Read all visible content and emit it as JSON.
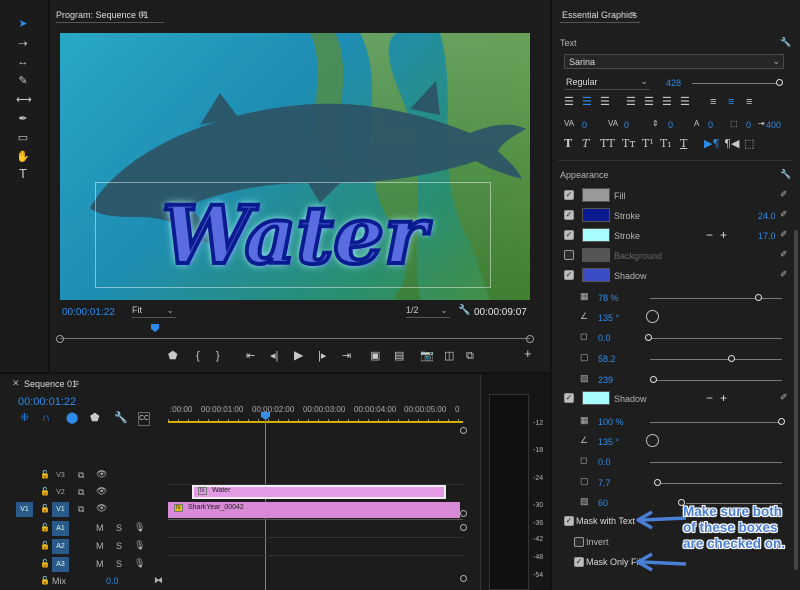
{
  "program": {
    "title": "Program: Sequence 01",
    "timecode_left": "00:00:01:22",
    "fit": "Fit",
    "resolution": "1/2",
    "timecode_right": "00:00:09:07",
    "preview_text": "Water"
  },
  "sequence": {
    "title": "Sequence 01",
    "timecode": "00:00:01:22",
    "ruler": [
      ":00:00",
      "00:00:01:00",
      "00:00:02:00",
      "00:00:03:00",
      "00:00:04:00",
      "00:00:05:00",
      "0"
    ],
    "tracks": [
      {
        "name": "V3",
        "src": ""
      },
      {
        "name": "V2",
        "src": ""
      },
      {
        "name": "V1",
        "src": "V1"
      },
      {
        "name": "A1",
        "src": ""
      },
      {
        "name": "A2",
        "src": ""
      },
      {
        "name": "A3",
        "src": ""
      }
    ],
    "mix_label": "Mix",
    "mix_value": "0.0",
    "clips": [
      {
        "label": "Water",
        "color": "#e39be6"
      },
      {
        "label": "SharkYear_00042",
        "color": "#d98ad6"
      }
    ],
    "meter_labels": [
      "-12",
      "-18",
      "-24",
      "-30",
      "-36",
      "-42",
      "-48",
      "-54"
    ]
  },
  "essential_graphics": {
    "title": "Essential Graphics",
    "text_section": "Text",
    "font": "Sarina",
    "style": "Regular",
    "size": "428",
    "tracking": [
      "0",
      "0",
      "0",
      "0",
      "0",
      "400"
    ],
    "appearance_section": "Appearance",
    "layers": [
      {
        "label": "Fill",
        "checked": true,
        "color": "#999999",
        "value": ""
      },
      {
        "label": "Stroke",
        "checked": true,
        "color": "#0a1a8f",
        "value": "24.0"
      },
      {
        "label": "Stroke",
        "checked": true,
        "color": "#a8fdff",
        "value": "17.0"
      },
      {
        "label": "Background",
        "checked": false,
        "color": "#555555",
        "value": ""
      },
      {
        "label": "Shadow",
        "checked": true,
        "color": "#3b4dc4",
        "value": ""
      }
    ],
    "shadow1": [
      "78 %",
      "135 °",
      "0.0",
      "58.2",
      "239"
    ],
    "shadow1_levels": [
      0.78,
      0.5,
      0.0,
      0.58,
      0.07
    ],
    "shadow2_label": "Shadow",
    "shadow2_color": "#a8fdff",
    "shadow2": [
      "100 %",
      "135 °",
      "0.0",
      "7.7",
      "60"
    ],
    "shadow2_levels": [
      1.0,
      0.5,
      0.0,
      0.03,
      0.2
    ],
    "mask_with_text": "Mask with Text",
    "invert": "Invert",
    "mask_only_fill": "Mask Only Fill"
  },
  "annotation": "Make sure both of these boxes are checked on.",
  "colors": {
    "accent": "#2d8ceb",
    "annotation": "#4a7fd6",
    "clip": "#d98ad6"
  }
}
